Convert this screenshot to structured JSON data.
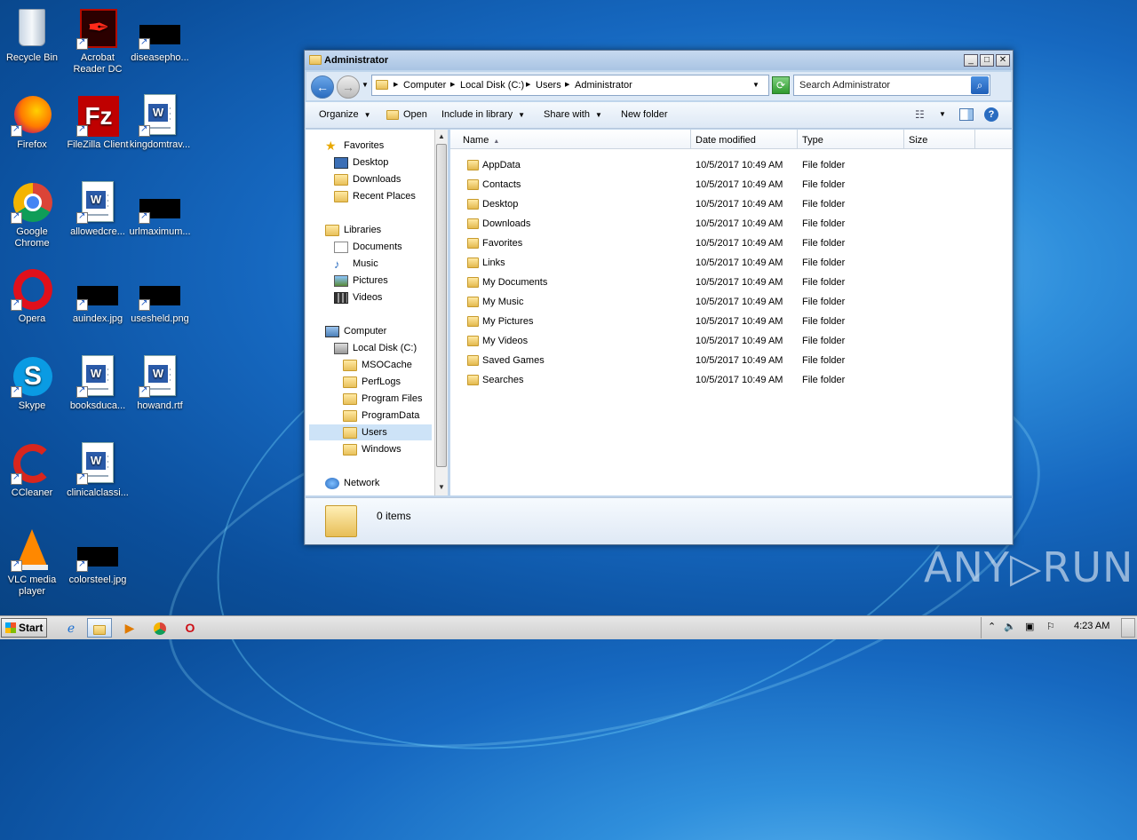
{
  "desktop": {
    "icons": [
      {
        "label_lines": [
          "Recycle Bin"
        ],
        "icon": "recycle-bin-icon"
      },
      {
        "label_lines": [
          "Acrobat",
          "Reader DC"
        ],
        "icon": "acrobat-icon"
      },
      {
        "label_lines": [
          "diseasepho..."
        ],
        "icon": "image-thumbnail-icon"
      },
      {
        "label_lines": [
          "Firefox"
        ],
        "icon": "firefox-icon"
      },
      {
        "label_lines": [
          "FileZilla Client"
        ],
        "icon": "filezilla-icon"
      },
      {
        "label_lines": [
          "kingdomtrav..."
        ],
        "icon": "word-document-icon"
      },
      {
        "label_lines": [
          "Google",
          "Chrome"
        ],
        "icon": "chrome-icon"
      },
      {
        "label_lines": [
          "allowedcre..."
        ],
        "icon": "word-document-icon"
      },
      {
        "label_lines": [
          "urlmaximum..."
        ],
        "icon": "image-thumbnail-icon"
      },
      {
        "label_lines": [
          "Opera"
        ],
        "icon": "opera-icon"
      },
      {
        "label_lines": [
          "auindex.jpg"
        ],
        "icon": "image-thumbnail-icon"
      },
      {
        "label_lines": [
          "usesheld.png"
        ],
        "icon": "image-thumbnail-icon"
      },
      {
        "label_lines": [
          "Skype"
        ],
        "icon": "skype-icon"
      },
      {
        "label_lines": [
          "booksduca..."
        ],
        "icon": "word-document-icon"
      },
      {
        "label_lines": [
          "howand.rtf"
        ],
        "icon": "word-document-icon"
      },
      {
        "label_lines": [
          "CCleaner"
        ],
        "icon": "ccleaner-icon"
      },
      {
        "label_lines": [
          "clinicalclassi..."
        ],
        "icon": "word-document-icon"
      },
      {
        "label_lines": [
          "VLC media",
          "player"
        ],
        "icon": "vlc-icon"
      },
      {
        "label_lines": [
          "colorsteel.jpg"
        ],
        "icon": "image-thumbnail-icon"
      }
    ]
  },
  "window": {
    "title": "Administrator",
    "minimize": "_",
    "maximize": "□",
    "close": "✕",
    "breadcrumb": [
      "Computer",
      "Local Disk (C:)",
      "Users",
      "Administrator"
    ],
    "search_placeholder": "Search Administrator",
    "toolbar": {
      "organize": "Organize",
      "open": "Open",
      "include": "Include in library",
      "share": "Share with",
      "new_folder": "New folder"
    },
    "nav": {
      "favorites": "Favorites",
      "desktop": "Desktop",
      "downloads": "Downloads",
      "recent": "Recent Places",
      "libraries": "Libraries",
      "documents": "Documents",
      "music": "Music",
      "pictures": "Pictures",
      "videos": "Videos",
      "computer": "Computer",
      "local_disk": "Local Disk (C:)",
      "folders": [
        "MSOCache",
        "PerfLogs",
        "Program Files",
        "ProgramData",
        "Users",
        "Windows"
      ],
      "network": "Network"
    },
    "columns": {
      "name": "Name",
      "date": "Date modified",
      "type": "Type",
      "size": "Size"
    },
    "files": [
      {
        "name": "AppData",
        "date": "10/5/2017 10:49 AM",
        "type": "File folder"
      },
      {
        "name": "Contacts",
        "date": "10/5/2017 10:49 AM",
        "type": "File folder"
      },
      {
        "name": "Desktop",
        "date": "10/5/2017 10:49 AM",
        "type": "File folder"
      },
      {
        "name": "Downloads",
        "date": "10/5/2017 10:49 AM",
        "type": "File folder"
      },
      {
        "name": "Favorites",
        "date": "10/5/2017 10:49 AM",
        "type": "File folder"
      },
      {
        "name": "Links",
        "date": "10/5/2017 10:49 AM",
        "type": "File folder"
      },
      {
        "name": "My Documents",
        "date": "10/5/2017 10:49 AM",
        "type": "File folder"
      },
      {
        "name": "My Music",
        "date": "10/5/2017 10:49 AM",
        "type": "File folder"
      },
      {
        "name": "My Pictures",
        "date": "10/5/2017 10:49 AM",
        "type": "File folder"
      },
      {
        "name": "My Videos",
        "date": "10/5/2017 10:49 AM",
        "type": "File folder"
      },
      {
        "name": "Saved Games",
        "date": "10/5/2017 10:49 AM",
        "type": "File folder"
      },
      {
        "name": "Searches",
        "date": "10/5/2017 10:49 AM",
        "type": "File folder"
      }
    ],
    "status": "0 items"
  },
  "taskbar": {
    "start": "Start",
    "time": "4:23 AM"
  },
  "watermark": "ANY▷RUN",
  "colors": {
    "accent": "#1f5fb8",
    "selection": "#cde3f7"
  }
}
